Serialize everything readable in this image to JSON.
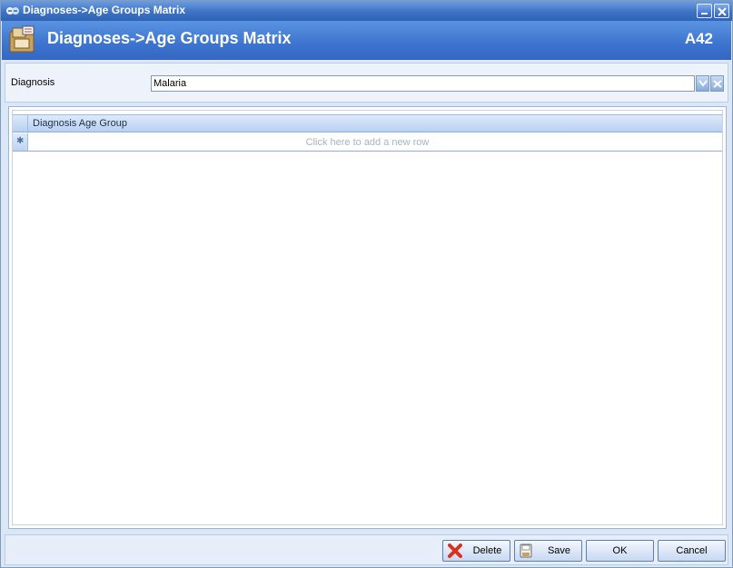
{
  "window": {
    "title": "Diagnoses->Age Groups Matrix"
  },
  "header": {
    "title": "Diagnoses->Age Groups Matrix",
    "code": "A42"
  },
  "filter": {
    "diagnosis_label": "Diagnosis",
    "diagnosis_value": "Malaria"
  },
  "grid": {
    "columns": [
      "Diagnosis Age Group"
    ],
    "new_row_marker": "✱",
    "new_row_text": "Click here to add a new row"
  },
  "buttons": {
    "delete": "Delete",
    "save": "Save",
    "ok": "OK",
    "cancel": "Cancel"
  },
  "colors": {
    "titlebar": "#3e72c4",
    "header": "#3c74cf",
    "panel": "#dbe6f6"
  }
}
